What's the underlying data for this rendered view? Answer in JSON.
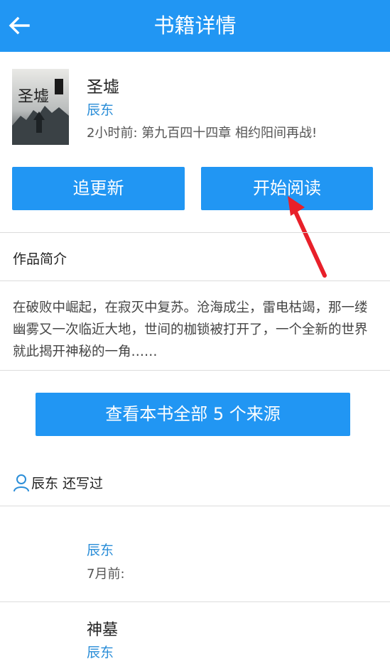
{
  "header": {
    "title": "书籍详情",
    "back_icon": "arrow-left-icon"
  },
  "book": {
    "title": "圣墟",
    "author": "辰东",
    "latest": "2小时前: 第九百四十四章 相约阳间再战!",
    "cover_text": "圣墟"
  },
  "actions": {
    "follow_label": "追更新",
    "read_label": "开始阅读"
  },
  "intro": {
    "heading": "作品简介",
    "text": "在破败中崛起，在寂灭中复苏。沧海成尘，雷电枯竭，那一缕幽雾又一次临近大地，世间的枷锁被打开了，一个全新的世界就此揭开神秘的一角……"
  },
  "sources": {
    "label": "查看本书全部 5 个来源"
  },
  "author_books": {
    "heading": "辰东 还写过",
    "items": [
      {
        "title": "",
        "author": "辰东",
        "time": "7月前:"
      },
      {
        "title": "神墓",
        "author": "辰东"
      }
    ]
  },
  "colors": {
    "primary": "#2196f3",
    "link": "#2b8ed8",
    "annotation": "#e8202a"
  }
}
